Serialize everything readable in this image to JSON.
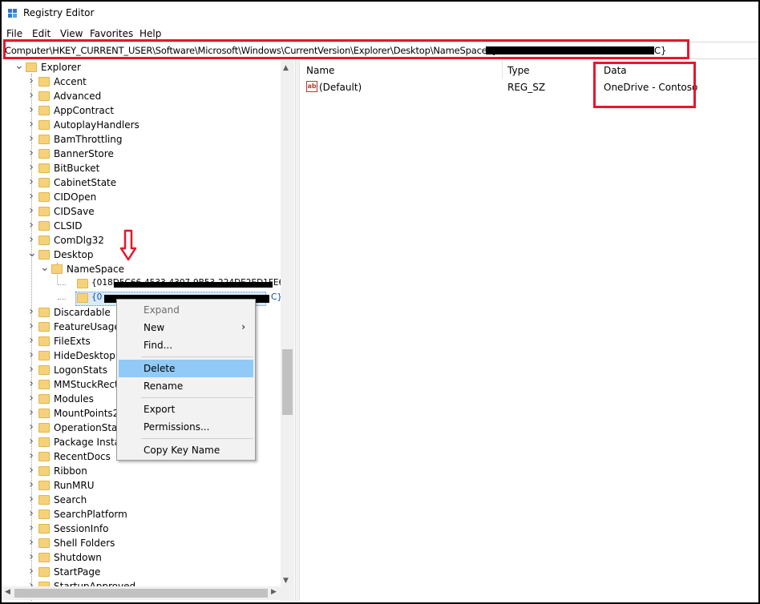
{
  "window": {
    "title": "Registry Editor"
  },
  "menu": [
    "File",
    "Edit",
    "View",
    "Favorites",
    "Help"
  ],
  "address": {
    "path": "Computer\\HKEY_CURRENT_USER\\Software\\Microsoft\\Windows\\CurrentVersion\\Explorer\\Desktop\\NameSpace\\{0",
    "tail": "C}"
  },
  "tree": [
    {
      "label": "Explorer",
      "expanded": true
    },
    {
      "label": "Accent"
    },
    {
      "label": "Advanced"
    },
    {
      "label": "AppContract"
    },
    {
      "label": "AutoplayHandlers"
    },
    {
      "label": "BamThrottling"
    },
    {
      "label": "BannerStore"
    },
    {
      "label": "BitBucket"
    },
    {
      "label": "CabinetState"
    },
    {
      "label": "CIDOpen"
    },
    {
      "label": "CIDSave"
    },
    {
      "label": "CLSID"
    },
    {
      "label": "ComDlg32"
    },
    {
      "label": "Desktop",
      "expanded": true
    },
    {
      "label": "NameSpace",
      "expanded": true
    },
    {
      "label": "{018D5C66-4533-4307-9B53-224DE2ED1FE6}"
    },
    {
      "label": "{0",
      "tail": "C}",
      "selected": true
    },
    {
      "label": "Discardable"
    },
    {
      "label": "FeatureUsage"
    },
    {
      "label": "FileExts"
    },
    {
      "label": "HideDesktopIcons"
    },
    {
      "label": "LogonStats"
    },
    {
      "label": "MMStuckRects3"
    },
    {
      "label": "Modules"
    },
    {
      "label": "MountPoints2"
    },
    {
      "label": "OperationStatusManager"
    },
    {
      "label": "Package Installation"
    },
    {
      "label": "RecentDocs"
    },
    {
      "label": "Ribbon"
    },
    {
      "label": "RunMRU"
    },
    {
      "label": "Search"
    },
    {
      "label": "SearchPlatform"
    },
    {
      "label": "SessionInfo"
    },
    {
      "label": "Shell Folders"
    },
    {
      "label": "Shutdown"
    },
    {
      "label": "StartPage"
    },
    {
      "label": "StartupApproved"
    }
  ],
  "list": {
    "headers": {
      "name": "Name",
      "type": "Type",
      "data": "Data"
    },
    "rows": [
      {
        "name": "(Default)",
        "type": "REG_SZ",
        "data": "OneDrive - Contoso",
        "icon": "string-value-icon"
      }
    ]
  },
  "context_menu": {
    "items": [
      {
        "label": "Expand",
        "disabled": true
      },
      {
        "label": "New",
        "submenu": true
      },
      {
        "label": "Find..."
      },
      {
        "label": "Delete",
        "highlighted": true
      },
      {
        "label": "Rename"
      },
      {
        "label": "Export"
      },
      {
        "label": "Permissions..."
      },
      {
        "label": "Copy Key Name"
      }
    ]
  },
  "colors": {
    "highlight_box": "#e8162b",
    "menu_highlight": "#91c9f7",
    "folder": "#f5d27a"
  }
}
